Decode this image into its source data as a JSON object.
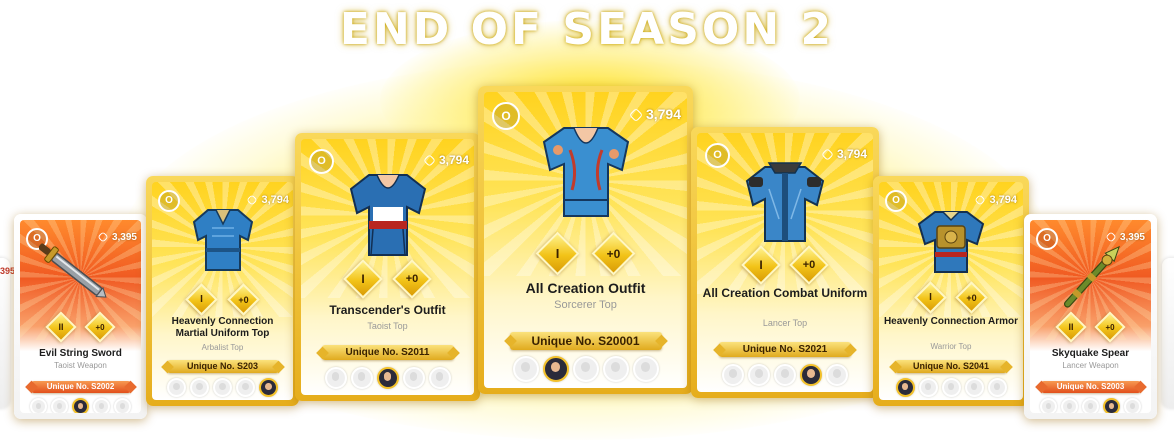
{
  "banner": {
    "title": "END OF SEASON 2"
  },
  "edge_left_price": "395",
  "cards": [
    {
      "name": "Evil String Sword",
      "type": "Taoist Weapon",
      "price": "3,395",
      "grade": "II",
      "enhance": "+0",
      "unique": "Unique No. S2002",
      "rarity_color": "#f05a22"
    },
    {
      "name": "Heavenly Connection Martial Uniform Top",
      "type": "Arbalist Top",
      "price": "3,794",
      "grade": "I",
      "enhance": "+0",
      "unique": "Unique No. S203",
      "rarity_color": "#f2c318"
    },
    {
      "name": "Transcender's Outfit",
      "type": "Taoist Top",
      "price": "3,794",
      "grade": "I",
      "enhance": "+0",
      "unique": "Unique No. S2011",
      "rarity_color": "#f2c318"
    },
    {
      "name": "All Creation Outfit",
      "type": "Sorcerer Top",
      "price": "3,794",
      "grade": "I",
      "enhance": "+0",
      "unique": "Unique No. S20001",
      "rarity_color": "#f2c318"
    },
    {
      "name": "All Creation Combat Uniform",
      "type": "Lancer Top",
      "price": "3,794",
      "grade": "I",
      "enhance": "+0",
      "unique": "Unique No. S2021",
      "rarity_color": "#f2c318"
    },
    {
      "name": "Heavenly Connection Armor",
      "type": "Warrior Top",
      "price": "3,794",
      "grade": "I",
      "enhance": "+0",
      "unique": "Unique No. S2041",
      "rarity_color": "#f2c318"
    },
    {
      "name": "Skyquake Spear",
      "type": "Lancer Weapon",
      "price": "3,395",
      "grade": "II",
      "enhance": "+0",
      "unique": "Unique No. S2003",
      "rarity_color": "#f05a22"
    }
  ],
  "icons": {
    "logo": "ow-logo-icon",
    "price": "crystal-icon",
    "grade": "grade-diamond-icon",
    "enhance": "enhance-diamond-icon",
    "avatar": "character-avatar-icon"
  }
}
